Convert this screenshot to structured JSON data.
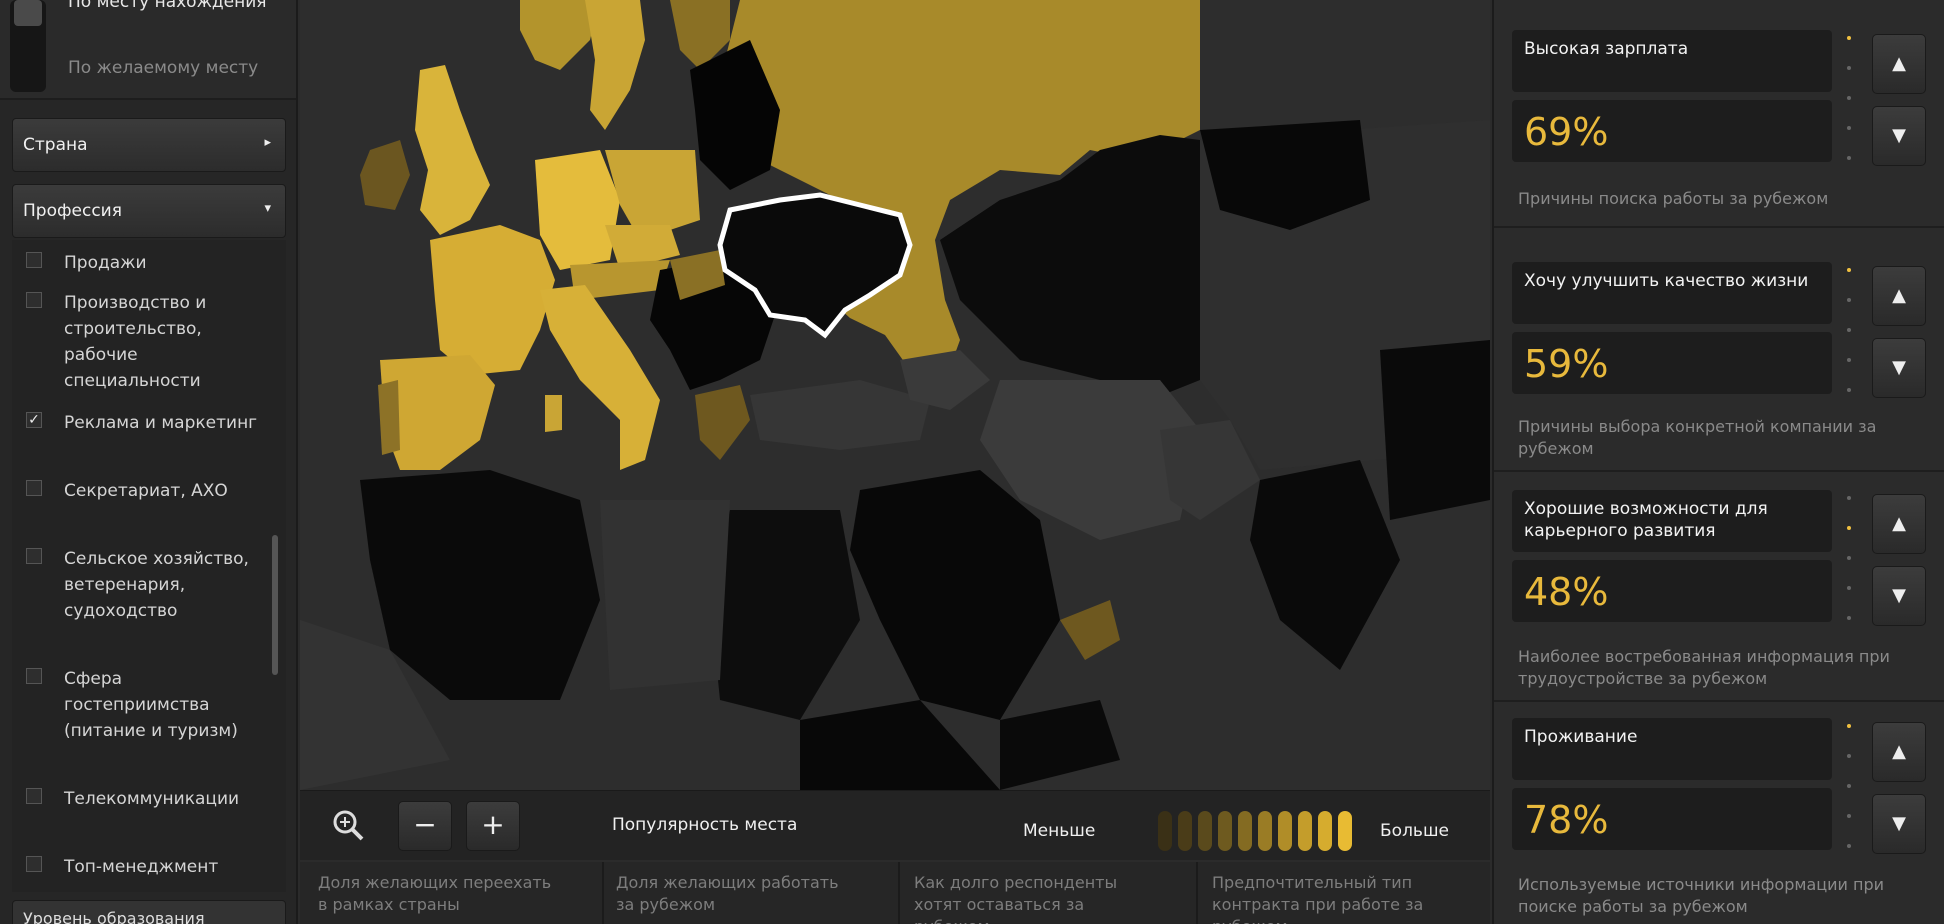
{
  "sidebar": {
    "top_options": [
      {
        "label": "По месту нахождения",
        "active": true
      },
      {
        "label": "По желаемому месту",
        "active": false
      }
    ],
    "country_dropdown": "Страна",
    "profession_dropdown": "Профессия",
    "professions": [
      {
        "label": "Продажи",
        "checked": false
      },
      {
        "label": "Производство и строительство, рабочие специальности",
        "checked": false
      },
      {
        "label": "Реклама и маркетинг",
        "checked": true
      },
      {
        "label": "Секретариат, АХО",
        "checked": false
      },
      {
        "label": "Сельское хозяйство, ветеренария, судоходство",
        "checked": false
      },
      {
        "label": "Сфера гостеприимства (питание и туризм)",
        "checked": false
      },
      {
        "label": "Телекоммуникации",
        "checked": false
      },
      {
        "label": "Топ-менеджмент",
        "checked": false
      }
    ],
    "checkmark": "✓",
    "bottom_dropdown": "Уровень образования"
  },
  "map_controls": {
    "zoom_icon": "magnifier-plus-icon",
    "minus": "−",
    "plus": "+",
    "popularity_label": "Популярность места",
    "less_label": "Меньше",
    "more_label": "Больше",
    "legend_colors": [
      "#3a3016",
      "#4a3c18",
      "#5a4a1c",
      "#6e5a1f",
      "#846b22",
      "#9a7c25",
      "#b08d28",
      "#c49d2b",
      "#d6ac2e",
      "#e8bb33"
    ]
  },
  "map_tabs": [
    "Доля желающих переехать в рамках страны",
    "Доля желающих работать за рубежом",
    "Как долго респонденты хотят оставаться за рубежом",
    "Предпочтительный тип контракта при работе за рубежом"
  ],
  "stats": [
    {
      "title": "Высокая зарплата",
      "value": "69%",
      "caption": "Причины поиска работы за рубежом"
    },
    {
      "title": "Хочу улучшить качество жизни",
      "value": "59%",
      "caption": "Причины выбора конкретной компании за рубежом"
    },
    {
      "title": "Хорошие возможности для карьерного развития",
      "value": "48%",
      "caption": "Наиболее востребованная информация при трудоустройстве за рубежом"
    },
    {
      "title": "Проживание",
      "value": "78%",
      "caption": "Используемые источники информации при поиске работы за рубежом"
    }
  ],
  "arrows": {
    "up": "▲",
    "down": "▼",
    "right": "▸",
    "down_small": "▾"
  },
  "colors": {
    "accent": "#e8b93c",
    "ukraine_outline": "#ffffff"
  }
}
